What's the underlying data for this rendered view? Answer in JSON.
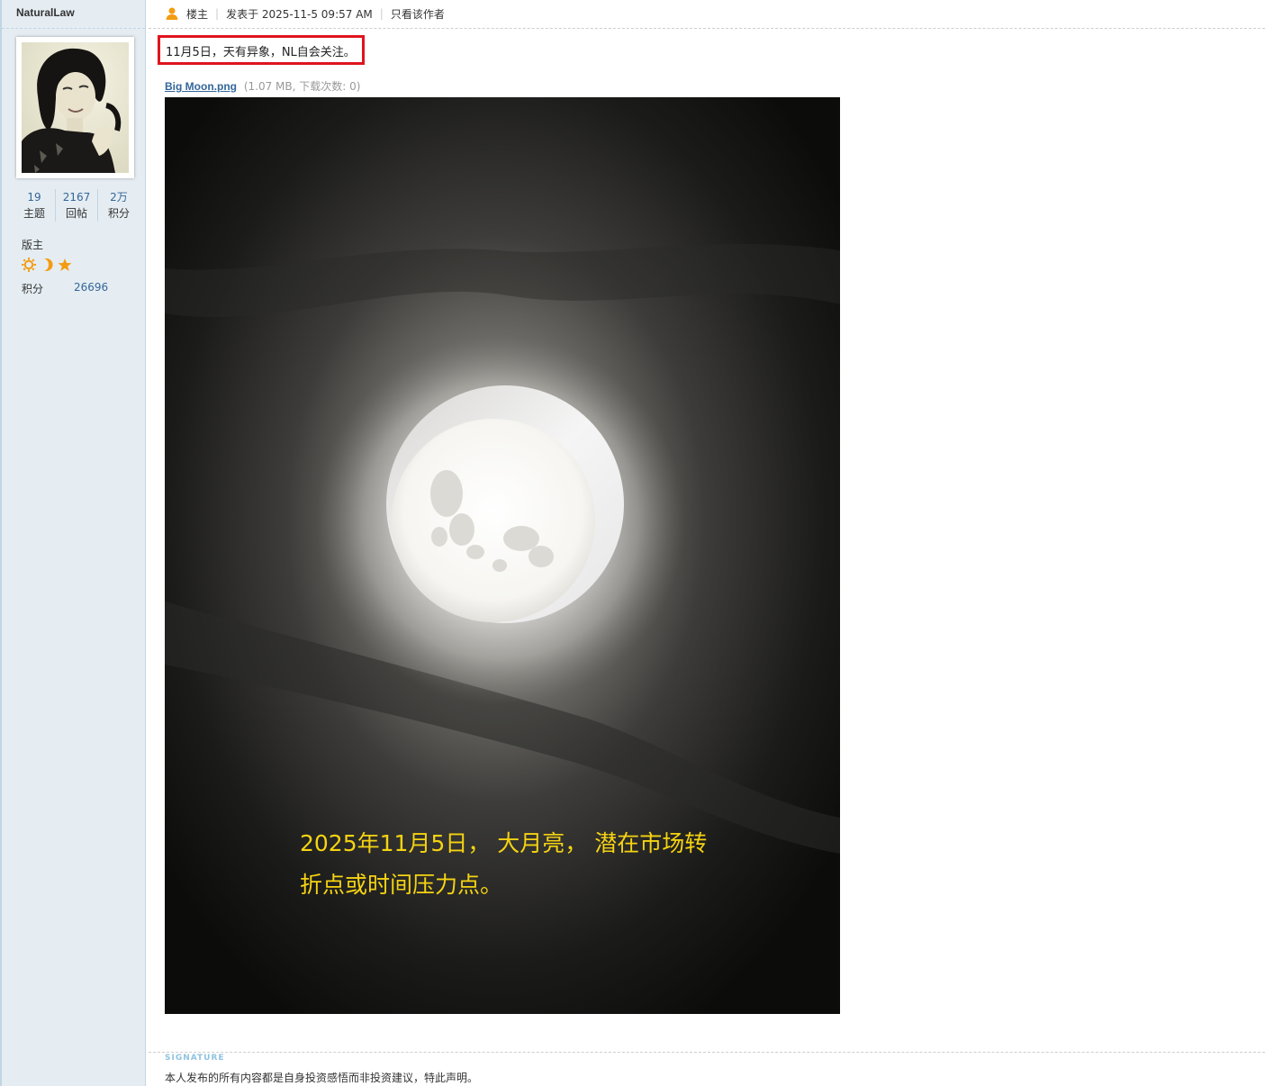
{
  "author": {
    "name": "NaturalLaw",
    "stats": [
      {
        "value": "19",
        "label": "主题"
      },
      {
        "value": "2167",
        "label": "回帖"
      },
      {
        "value": "2万",
        "label": "积分"
      }
    ],
    "rank": "版主",
    "rank_icons": [
      "sun-icon",
      "moon-icon",
      "star-icon"
    ],
    "points_label": "积分",
    "points_value": "26696"
  },
  "post": {
    "role": "楼主",
    "posted": "发表于 2025-11-5 09:57 AM",
    "only_author": "只看该作者",
    "text": "11月5日，天有异象，NL自会关注。",
    "attachment": {
      "file_name": "Big Moon.png",
      "info": "(1.07 MB, 下载次数: 0)"
    },
    "image_caption": {
      "line1": "2025年11月5日， 大月亮， 潜在市场转",
      "line2": "折点或时间压力点。"
    }
  },
  "signature": {
    "label": "SIGNATURE",
    "text": "本人发布的所有内容都是自身投资感悟而非投资建议，特此声明。"
  },
  "colors": {
    "link": "#336699",
    "highlight_border": "#e0141e",
    "caption": "#f5d312",
    "icon_orange": "#f39c12"
  }
}
